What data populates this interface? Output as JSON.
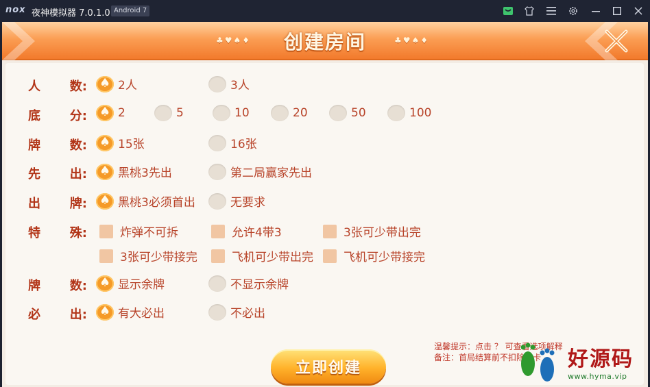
{
  "window": {
    "logo": "nox",
    "title": "夜神模拟器 7.0.1.0",
    "badge": "Android 7",
    "icons": [
      "store-icon",
      "shirt-icon",
      "menu-icon",
      "gear-icon",
      "minimize-icon",
      "maximize-icon",
      "close-icon"
    ]
  },
  "dialog": {
    "title": "创建房间",
    "deco": "♣♥♠♦",
    "close_icon": "crossed-close-icon"
  },
  "rows": [
    {
      "label": [
        "人",
        "数:"
      ],
      "options": [
        {
          "text": "2人",
          "selected": true
        },
        {
          "text": "3人",
          "selected": false
        }
      ]
    },
    {
      "label": [
        "底",
        "分:"
      ],
      "options": [
        {
          "text": "2",
          "selected": true
        },
        {
          "text": "5",
          "selected": false
        },
        {
          "text": "10",
          "selected": false
        },
        {
          "text": "20",
          "selected": false
        },
        {
          "text": "50",
          "selected": false
        },
        {
          "text": "100",
          "selected": false
        }
      ]
    },
    {
      "label": [
        "牌",
        "数:"
      ],
      "options": [
        {
          "text": "15张",
          "selected": true
        },
        {
          "text": "16张",
          "selected": false
        }
      ]
    },
    {
      "label": [
        "先",
        "出:"
      ],
      "options": [
        {
          "text": "黑桃3先出",
          "selected": true
        },
        {
          "text": "第二局赢家先出",
          "selected": false
        }
      ]
    },
    {
      "label": [
        "出",
        "牌:"
      ],
      "options": [
        {
          "text": "黑桃3必须首出",
          "selected": true
        },
        {
          "text": "无要求",
          "selected": false
        }
      ]
    },
    {
      "label": [
        "特",
        "殊:"
      ],
      "checks": [
        {
          "text": "炸弹不可拆",
          "checked": false
        },
        {
          "text": "允许4带3",
          "checked": false
        },
        {
          "text": "3张可少带出完",
          "checked": false
        },
        {
          "text": "3张可少带接完",
          "checked": false
        },
        {
          "text": "飞机可少带出完",
          "checked": false
        },
        {
          "text": "飞机可少带接完",
          "checked": false
        }
      ]
    },
    {
      "label": [
        "牌",
        "数:"
      ],
      "options": [
        {
          "text": "显示余牌",
          "selected": true
        },
        {
          "text": "不显示余牌",
          "selected": false
        }
      ]
    },
    {
      "label": [
        "必",
        "出:"
      ],
      "options": [
        {
          "text": "有大必出",
          "selected": true
        },
        {
          "text": "不必出",
          "selected": false
        }
      ]
    }
  ],
  "create_button": "立即创建",
  "tips": {
    "line1": "温馨提示：点击 ？ 可查看选项解释",
    "line2": "备注：首局结算前不扣除房卡"
  },
  "watermark": {
    "text": "好源码",
    "url": "www.hyma.vip"
  },
  "colors": {
    "accent": "#f59a27",
    "label": "#b23417",
    "option_text": "#b8442a",
    "header": "#f27a2c"
  }
}
